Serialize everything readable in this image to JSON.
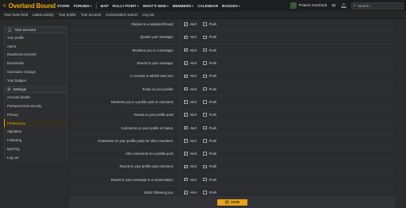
{
  "brand": {
    "name": "Overland Bound",
    "accent": "#f0a500"
  },
  "nav": {
    "items": [
      {
        "label": "STORE",
        "caret": false
      },
      {
        "label": "FORUMS",
        "caret": true
      },
      {
        "label": "MAP",
        "caret": false
      },
      {
        "label": "RALLY POINT",
        "caret": true
      },
      {
        "label": "WHAT'S NEW",
        "caret": true
      },
      {
        "label": "MEMBERS",
        "caret": true
      },
      {
        "label": "CALENDAR",
        "caret": false
      },
      {
        "label": "BADGES",
        "caret": true
      }
    ],
    "user_name": "Polaris Overland",
    "search_placeholder": "Search..."
  },
  "subnav": [
    "Your news feed",
    "Latest activity",
    "Your profile",
    "Your account",
    "Conversation search",
    "Log out"
  ],
  "sidebar": {
    "account_header": "Your account",
    "account_items": [
      "Your profile",
      "Alerts",
      "Reactions received",
      "Bookmarks",
      "Username Change",
      "Your badges"
    ],
    "settings_header": "Settings",
    "settings_items": [
      "Account details",
      "Password and security",
      "Privacy",
      "Preferences",
      "Signature",
      "Following",
      "Ignoring",
      "Log out"
    ],
    "active_item": "Preferences"
  },
  "options": {
    "alert_label": "Alert",
    "push_label": "Push"
  },
  "rows": [
    {
      "label": "Replies to a watched thread:",
      "alert": true,
      "push": false
    },
    {
      "label": "Quotes your message:",
      "alert": true,
      "push": false
    },
    {
      "label": "Mentions you in a message:",
      "alert": true,
      "push": false
    },
    {
      "label": "Reacts to your message:",
      "alert": true,
      "push": false
    },
    {
      "label": "A Location is added near you:",
      "alert": true,
      "push": false
    },
    {
      "label": "Posts on your profile:",
      "alert": true,
      "push": false
    },
    {
      "label": "Mentions you in a profile post or comment:",
      "alert": true,
      "push": false
    },
    {
      "label": "Reacts to your profile post:",
      "alert": true,
      "push": false
    },
    {
      "label": "Comments on your profile or status:",
      "alert": true,
      "push": false
    },
    {
      "label": "Comments on your profile posts for other members:",
      "alert": true,
      "push": false
    },
    {
      "label": "Also comments on a profile post:",
      "alert": true,
      "push": false
    },
    {
      "label": "Reacts to your profile post comment:",
      "alert": true,
      "push": false
    },
    {
      "label": "Reacts to your message in a conversation:",
      "alert": true,
      "push": false
    },
    {
      "label": "Starts following you:",
      "alert": true,
      "push": false
    }
  ],
  "save_label": "SAVE"
}
